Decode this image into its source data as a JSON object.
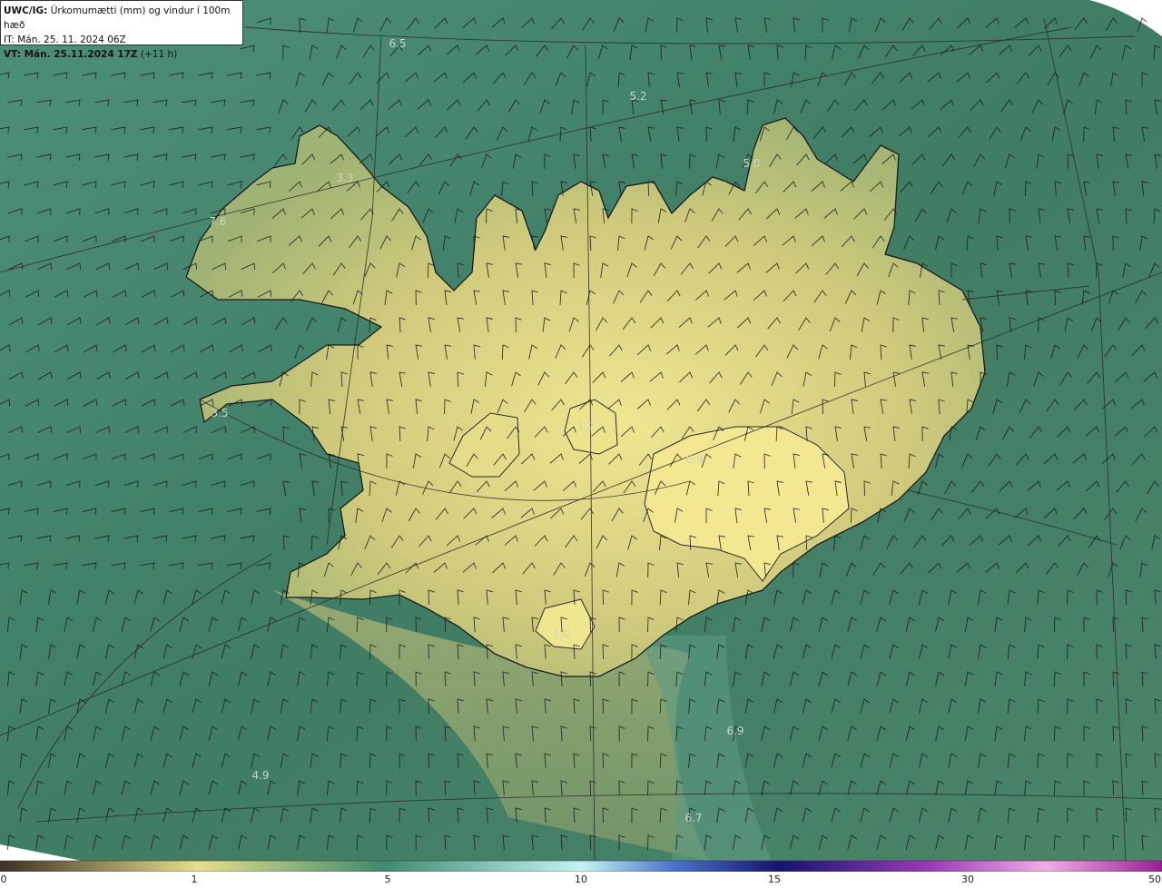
{
  "header": {
    "model": "UWC/IG:",
    "title": "Úrkomumætti (mm) og vindur í 100m hæð",
    "it_line": "IT: Mán. 25. 11. 2024 06Z",
    "vt_bold": "VT: Mán. 25.11.2024 17Z",
    "vt_offset": "(+11 h)"
  },
  "map_labels": [
    {
      "text": "6.5"
    },
    {
      "text": "5.2"
    },
    {
      "text": "5.0"
    },
    {
      "text": "3.3"
    },
    {
      "text": "7.6"
    },
    {
      "text": "3.5"
    },
    {
      "text": "1.2"
    },
    {
      "text": "0.9"
    },
    {
      "text": "1.0"
    },
    {
      "text": "6.9"
    },
    {
      "text": "4.9"
    },
    {
      "text": "6.7"
    }
  ],
  "colorbar": {
    "ticks": [
      "0",
      "1",
      "5",
      "10",
      "15",
      "30",
      "50"
    ],
    "colors": [
      "#4a3a2a",
      "#b9a463",
      "#e6e08a",
      "#3f8a6e",
      "#1f5e5a",
      "#bff4f4",
      "#4a73c9",
      "#14146e",
      "#8a2aa8",
      "#f0a8e0",
      "#b43fa8",
      "#8a1a8a"
    ]
  },
  "colors": {
    "ocean": "#3e7a62",
    "land_high": "#efe48f",
    "land_mid": "#c9c77a",
    "coast": "#1b1b1b",
    "grid": "#2a2a2a"
  }
}
